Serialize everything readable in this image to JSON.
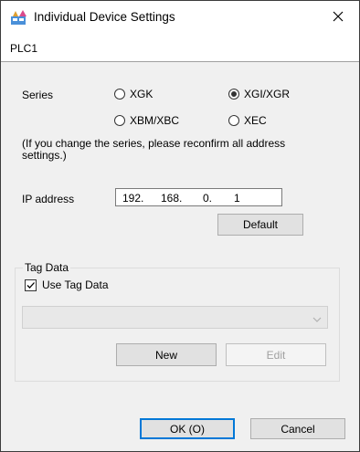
{
  "window": {
    "title": "Individual Device Settings",
    "subheader": "PLC1"
  },
  "series": {
    "label": "Series",
    "options": [
      {
        "label": "XGK",
        "checked": false
      },
      {
        "label": "XGI/XGR",
        "checked": true
      },
      {
        "label": "XBM/XBC",
        "checked": false
      },
      {
        "label": "XEC",
        "checked": false
      }
    ],
    "note": "(If you change the series, please reconfirm all address settings.)"
  },
  "ip": {
    "label": "IP address",
    "octets": [
      "192.",
      "168.",
      "0.",
      "1"
    ]
  },
  "buttons": {
    "default": "Default",
    "new": "New",
    "edit": "Edit",
    "ok": "OK (O)",
    "cancel": "Cancel"
  },
  "tag_data": {
    "group_label": "Tag Data",
    "use_tag_label": "Use Tag Data",
    "use_tag_checked": true,
    "combo_value": ""
  },
  "icons": {
    "app": "settings-device-icon",
    "close": "close-icon",
    "combo_arrow": "chevron-down-icon"
  }
}
